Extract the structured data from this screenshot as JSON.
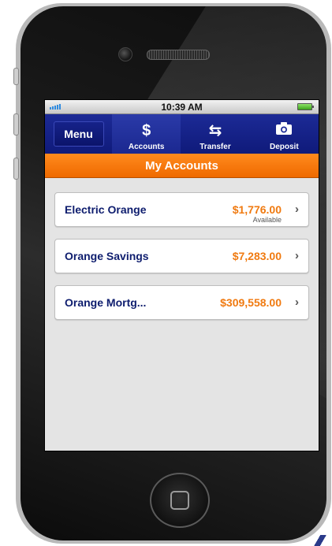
{
  "status_bar": {
    "time": "10:39 AM"
  },
  "nav": {
    "menu_label": "Menu",
    "items": [
      {
        "label": "Accounts",
        "icon": "dollar-icon",
        "glyph": "$"
      },
      {
        "label": "Transfer",
        "icon": "transfer-arrows-icon",
        "glyph": "⇆"
      },
      {
        "label": "Deposit",
        "icon": "camera-icon",
        "glyph": "📷"
      }
    ]
  },
  "title": "My Accounts",
  "accounts": [
    {
      "name": "Electric Orange",
      "amount": "$1,776.00",
      "sub": "Available"
    },
    {
      "name": "Orange Savings",
      "amount": "$7,283.00"
    },
    {
      "name": "Orange Mortg...",
      "amount": "$309,558.00"
    }
  ],
  "colors": {
    "nav_blue": "#1c2a96",
    "orange": "#f07a10",
    "account_name": "#0e1d6e"
  }
}
